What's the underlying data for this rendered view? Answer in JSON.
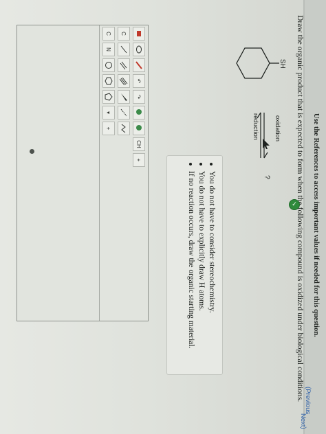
{
  "header": {
    "references_note": "Use the References to access important values if needed for this question."
  },
  "question": {
    "prompt": "Draw the organic product that is expected to form when the following compound is oxidized under biological conditions."
  },
  "reaction": {
    "substituent": "SH",
    "upper_label": "oxidation",
    "lower_label": "reduction",
    "product_placeholder": "?"
  },
  "hints": [
    "You do not have to consider stereochemistry.",
    "You do not have to explicitly draw H atoms.",
    "If no reaction occurs, draw the organic starting material."
  ],
  "toolbar": {
    "row1": [
      "C",
      "H",
      "↶",
      "↷",
      "↻",
      "−",
      "⌫"
    ],
    "row2": [
      "C",
      "≡",
      "/",
      "—",
      "≡",
      "╱",
      "⟋"
    ],
    "row3": [
      "C",
      "N",
      "◯",
      "⬡",
      "⬠",
      "▾",
      "+"
    ],
    "tool_text_ch": "CH",
    "charge_labels": [
      "+",
      "−"
    ]
  },
  "nav": {
    "previous_label": "Previous",
    "next_label": "Next"
  },
  "colors": {
    "badge": "#2f8a3c",
    "link": "#2a5ea8"
  }
}
